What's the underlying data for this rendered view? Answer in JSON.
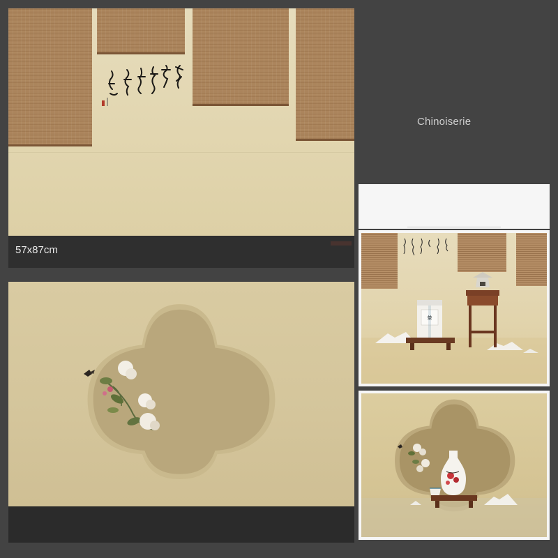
{
  "label": "Chinoiserie",
  "size_caption": "57x87cm",
  "panels": [
    {
      "name": "bamboo-blinds-backdrop"
    },
    {
      "name": "quatrefoil-window-backdrop"
    },
    {
      "name": "blank-preview"
    },
    {
      "name": "tea-tin-styled-scene"
    },
    {
      "name": "porcelain-bottle-styled-scene"
    }
  ],
  "colors": {
    "page_background": "#434343",
    "backdrop_cream": "#e2d6b0",
    "backdrop_khaki": "#d4c59b",
    "bamboo": "#a47c54",
    "rosewood": "#7a3e22"
  }
}
